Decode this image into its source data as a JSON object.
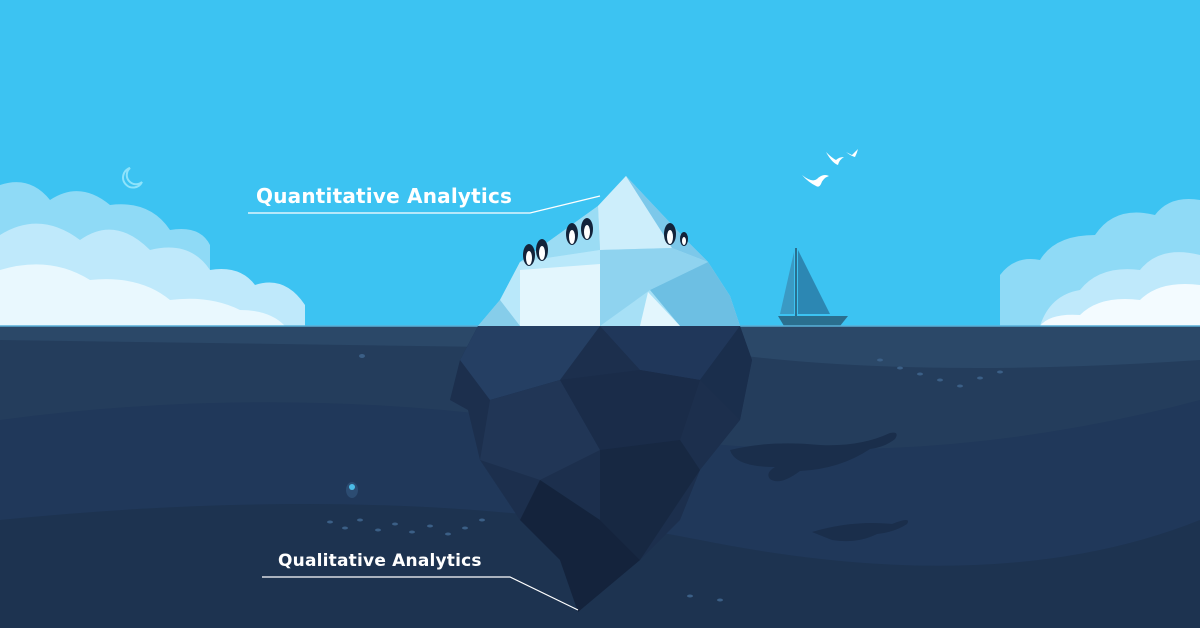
{
  "labels": {
    "above_water": "Quantitative Analytics",
    "below_water": "Qualitative Analytics"
  },
  "colors": {
    "sky": "#3cc3f2",
    "water": "#243d5c",
    "water_deep": "#1d3350",
    "iceberg_light": "#cdeefb",
    "iceberg_mid": "#8fd3ef",
    "iceberg_under": "#1c2f4d",
    "label_text": "#ffffff"
  },
  "icons": [
    "cloud-icon",
    "moon-icon",
    "seagull-icon",
    "penguin-icon",
    "sailboat-icon",
    "whale-icon",
    "diver-icon",
    "fish-school-icon"
  ]
}
